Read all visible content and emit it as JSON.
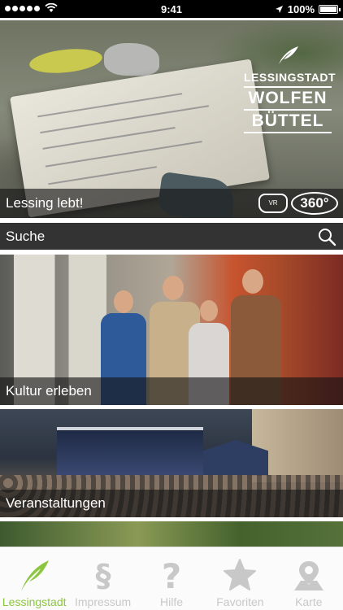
{
  "status_bar": {
    "time": "9:41",
    "battery": "100%"
  },
  "hero": {
    "caption": "Lessing lebt!",
    "logo_line1": "LESSINGSTADT",
    "logo_line2": "WOLFEN",
    "logo_line3": "BÜTTEL",
    "vr_label": "VR",
    "panorama_label": "360°"
  },
  "search": {
    "label": "Suche"
  },
  "tiles": [
    {
      "caption": "Kultur erleben"
    },
    {
      "caption": "Veranstaltungen"
    }
  ],
  "tabbar": {
    "items": [
      {
        "label": "Lessingstadt",
        "icon": "quill-icon",
        "active": true
      },
      {
        "label": "Impressum",
        "icon": "paragraph-icon",
        "active": false
      },
      {
        "label": "Hilfe",
        "icon": "question-icon",
        "active": false
      },
      {
        "label": "Favoriten",
        "icon": "star-icon",
        "active": false
      },
      {
        "label": "Karte",
        "icon": "map-pin-icon",
        "active": false
      }
    ]
  },
  "colors": {
    "accent": "#8cc63f",
    "inactive": "#c8c8c8",
    "bar_dark": "#333333"
  }
}
